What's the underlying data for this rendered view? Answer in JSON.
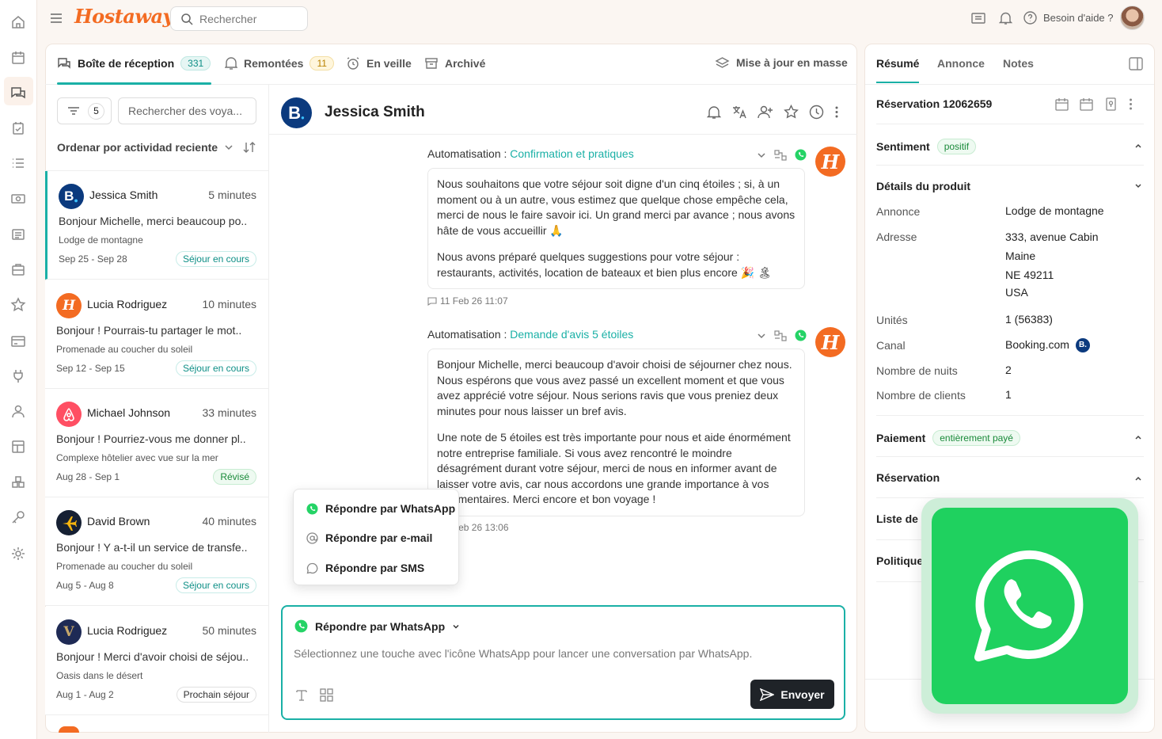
{
  "app": {
    "logo": "Hostaway",
    "search_placeholder": "Rechercher",
    "help": "Besoin d'aide ?"
  },
  "tabs": [
    {
      "label": "Boîte de réception",
      "count": "331"
    },
    {
      "label": "Remontées",
      "count": "11"
    },
    {
      "label": "En veille"
    },
    {
      "label": "Archivé"
    }
  ],
  "bulk_update": "Mise à jour en masse",
  "list": {
    "filter_count": "5",
    "search_placeholder": "Rechercher des voya...",
    "sort": "Ordenar por actividad reciente",
    "items": [
      {
        "name": "Jessica Smith",
        "time": "5 minutes",
        "preview": "Bonjour Michelle, merci beaucoup po..",
        "listing": "Lodge de montagne",
        "dates": "Sep 25 - Sep 28",
        "status": "Séjour en cours"
      },
      {
        "name": "Lucia Rodriguez",
        "time": "10 minutes",
        "preview": "Bonjour ! Pourrais-tu partager le mot..",
        "listing": "Promenade au coucher du soleil",
        "dates": "Sep 12 - Sep 15",
        "status": "Séjour en cours"
      },
      {
        "name": "Michael Johnson",
        "time": "33 minutes",
        "preview": "Bonjour ! Pourriez-vous me donner pl..",
        "listing": "Complexe hôtelier avec vue sur la mer",
        "dates": "Aug 28 - Sep 1",
        "status": "Révisé"
      },
      {
        "name": "David Brown",
        "time": "40 minutes",
        "preview": "Bonjour ! Y a-t-il un service de transfe..",
        "listing": "Promenade au coucher du soleil",
        "dates": "Aug 5 - Aug 8",
        "status": "Séjour en cours"
      },
      {
        "name": "Lucia Rodriguez",
        "time": "50 minutes",
        "preview": "Bonjour ! Merci d'avoir choisi de séjou..",
        "listing": "Oasis dans le désert",
        "dates": "Aug 1 - Aug 2",
        "status": "Prochain séjour"
      }
    ]
  },
  "conversation": {
    "guest": "Jessica Smith",
    "messages": [
      {
        "label": "Automatisation :",
        "template": "Confirmation et pratiques",
        "p1": "Nous souhaitons que votre séjour soit digne d'un cinq étoiles ; si, à un moment ou à un autre, vous estimez que quelque chose empêche cela, merci de nous le faire savoir ici. Un grand merci par avance ; nous avons hâte de vous accueillir 🙏",
        "p2": "Nous avons préparé quelques suggestions pour votre séjour : restaurants, activités, location de bateaux et bien plus encore 🎉 🏝",
        "time": "11 Feb 26 11:07"
      },
      {
        "label": "Automatisation :",
        "template": "Demande d'avis 5 étoiles",
        "p1": "Bonjour Michelle, merci beaucoup d'avoir choisi de séjourner chez nous. Nous espérons que vous avez passé un excellent moment et que vous avez apprécié votre séjour. Nous serions ravis que vous preniez deux minutes pour nous laisser un bref avis.",
        "p2": "Une note de 5 étoiles est très importante pour nous et aide énormément notre entreprise familiale. Si vous avez rencontré le moindre désagrément durant votre séjour, merci de nous en informer avant de laisser votre avis, car nous accordons une grande importance à vos commentaires. Merci encore et bon voyage !",
        "time": "11 Feb 26 13:06"
      }
    ],
    "reply_menu": [
      "Répondre par WhatsApp",
      "Répondre par e-mail",
      "Répondre par SMS"
    ],
    "composer": {
      "channel": "Répondre par WhatsApp",
      "placeholder": "Sélectionnez une touche avec l'icône WhatsApp pour lancer une conversation par WhatsApp.",
      "send": "Envoyer"
    }
  },
  "right": {
    "tabs": [
      "Résumé",
      "Annonce",
      "Notes"
    ],
    "reservation": "Réservation 12062659",
    "sentiment": {
      "label": "Sentiment",
      "value": "positif"
    },
    "details_title": "Détails du produit",
    "details": [
      {
        "k": "Annonce",
        "v": "Lodge de montagne"
      },
      {
        "k": "Adresse",
        "v": "333, avenue Cabin"
      },
      {
        "k": "",
        "v": "Maine"
      },
      {
        "k": "",
        "v": "NE 49211"
      },
      {
        "k": "",
        "v": "USA"
      },
      {
        "k": "Unités",
        "v": "1 (56383)"
      },
      {
        "k": "Canal",
        "v": "Booking.com"
      },
      {
        "k": "Nombre de nuits",
        "v": "2"
      },
      {
        "k": "Nombre de clients",
        "v": "1"
      }
    ],
    "payment": {
      "label": "Paiement",
      "value": "entièrement payé"
    },
    "reservation_section": "Réservation",
    "list_section": "Liste de c",
    "policy_section": "Politique"
  },
  "colors": {
    "brand": "#f36b22",
    "teal": "#1ab0a6",
    "whatsapp": "#25d366"
  }
}
